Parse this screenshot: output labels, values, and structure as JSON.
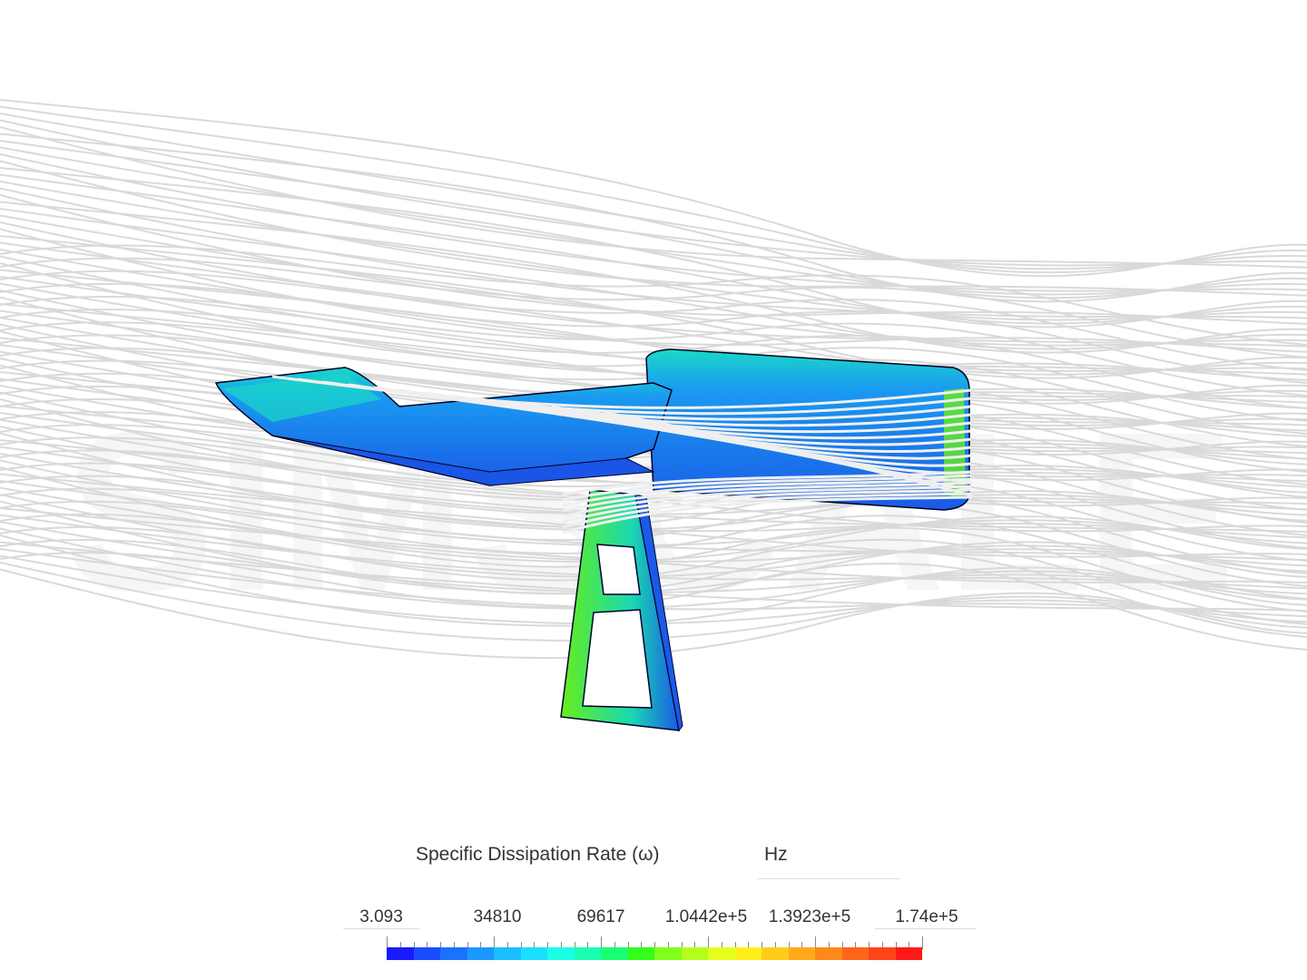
{
  "legend": {
    "title": "Specific Dissipation Rate (ω)",
    "unit": "Hz",
    "tick_labels": [
      "3.093",
      "34810",
      "69617",
      "1.0442e+5",
      "1.3923e+5",
      "1.74e+5"
    ],
    "min": 3.093,
    "max": 174000,
    "colors": [
      "#1a1aff",
      "#1a4dff",
      "#1a73ff",
      "#1a99ff",
      "#1abfff",
      "#1ae0ff",
      "#1affe6",
      "#1affb3",
      "#1aff73",
      "#33ff1a",
      "#80ff1a",
      "#b3ff1a",
      "#e6ff1a",
      "#ffee1a",
      "#ffcc1a",
      "#ffaa1a",
      "#ff881a",
      "#ff661a",
      "#ff441a",
      "#ff1a1a"
    ]
  },
  "model": {
    "name": "rear wing with support strut",
    "color_low": "#1a55e6",
    "color_mid": "#1ad9d9",
    "color_high": "#66ee1a",
    "streamline_color": "#d9d9d9"
  },
  "watermark": {
    "text": "SIMSCALE",
    "color": "#f4f6f8"
  }
}
